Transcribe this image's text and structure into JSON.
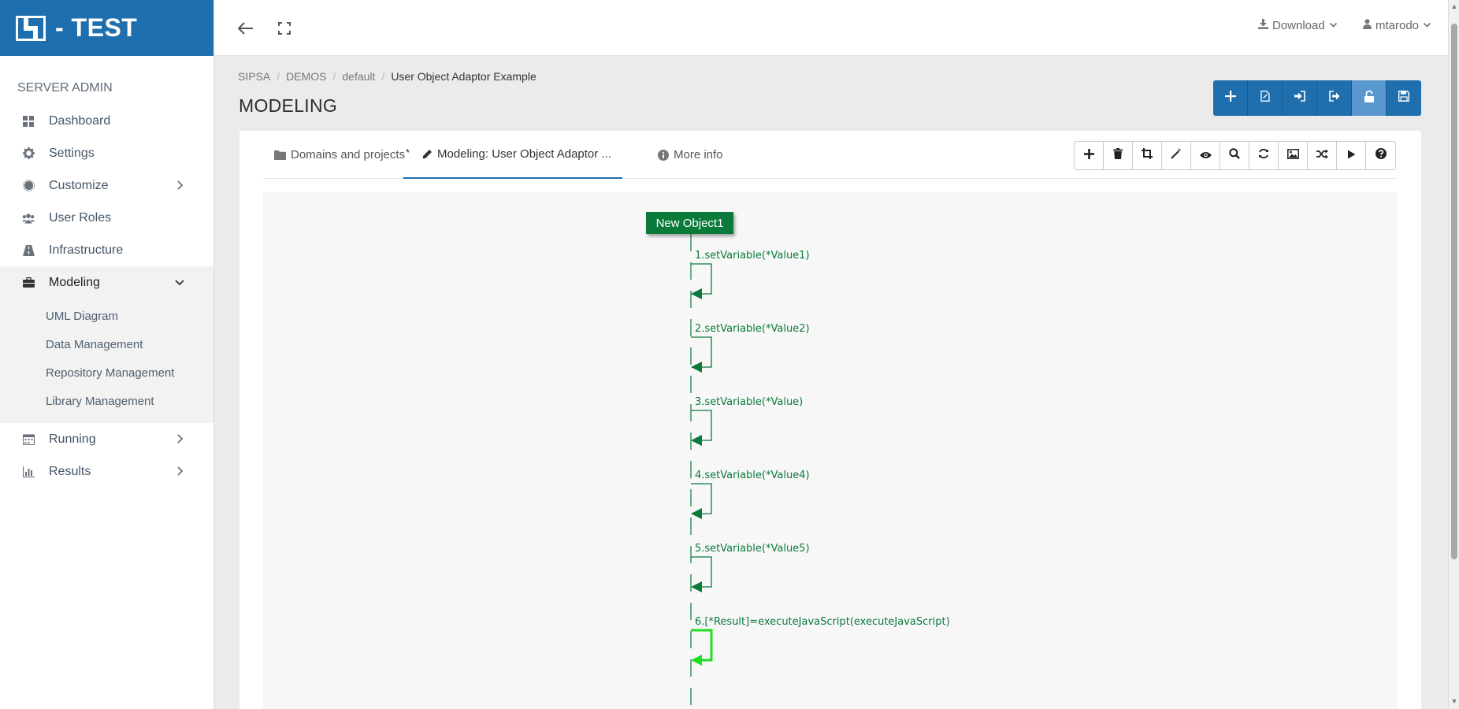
{
  "brand": {
    "title": "- TEST"
  },
  "sidebar": {
    "section_label": "SERVER ADMIN",
    "items": [
      {
        "label": "Dashboard"
      },
      {
        "label": "Settings"
      },
      {
        "label": "Customize"
      },
      {
        "label": "User Roles"
      },
      {
        "label": "Infrastructure"
      },
      {
        "label": "Modeling"
      },
      {
        "label": "Running"
      },
      {
        "label": "Results"
      }
    ],
    "subitems": [
      {
        "label": "UML Diagram"
      },
      {
        "label": "Data Management"
      },
      {
        "label": "Repository Management"
      },
      {
        "label": "Library Management"
      }
    ]
  },
  "topbar": {
    "download_label": "Download",
    "user_label": "mtarodo"
  },
  "breadcrumb": [
    "SIPSA",
    "DEMOS",
    "default",
    "User Object Adaptor Example"
  ],
  "page_title": "MODELING",
  "tabs": [
    {
      "label": "Domains and projects"
    },
    {
      "label": "Modeling: User Object Adaptor ...",
      "dirty_marker": "*"
    },
    {
      "label": "More info"
    }
  ],
  "diagram": {
    "object_name": "New Object1",
    "messages": [
      {
        "label": "1.setVariable(*Value1)"
      },
      {
        "label": "2.setVariable(*Value2)"
      },
      {
        "label": "3.setVariable(*Value)"
      },
      {
        "label": "4.setVariable(*Value4)"
      },
      {
        "label": "5.setVariable(*Value5)"
      },
      {
        "label": "6.[*Result]=executeJavaScript(executeJavaScript)",
        "highlighted": true
      }
    ],
    "colors": {
      "primary": "#0a7a3a",
      "highlight": "#22dd22"
    }
  },
  "colors": {
    "brand": "#1f6fae",
    "sidebar_active": "#f2f2f2"
  }
}
